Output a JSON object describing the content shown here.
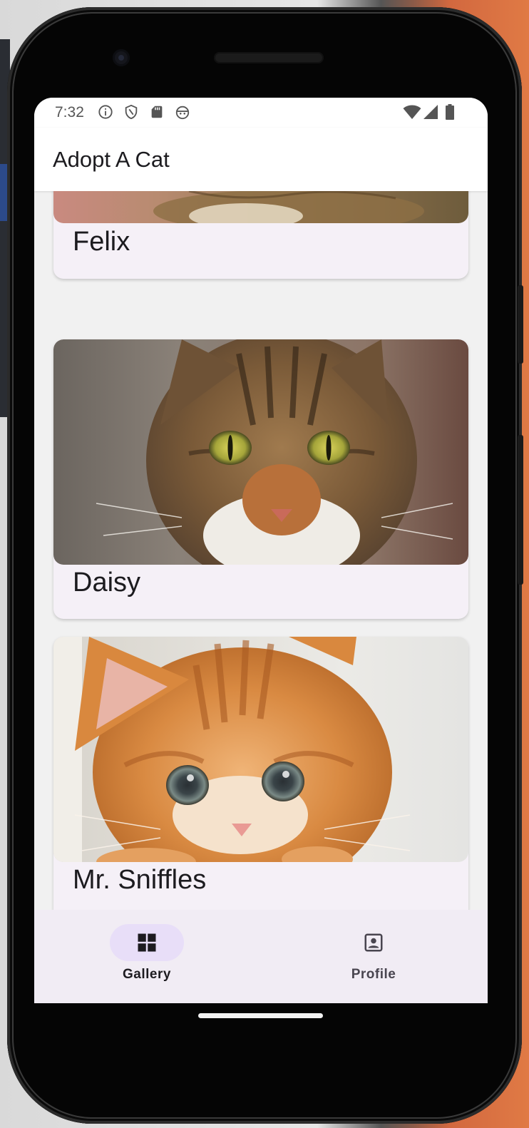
{
  "status_bar": {
    "time": "7:32",
    "left_icons": [
      "info-icon",
      "shield-icon",
      "sd-card-icon",
      "android-face-icon"
    ],
    "right_icons": [
      "wifi-icon",
      "cell-signal-icon",
      "battery-icon"
    ]
  },
  "app_bar": {
    "title": "Adopt A Cat"
  },
  "cats": [
    {
      "name": "Felix",
      "photo": "tabby-cat-photo"
    },
    {
      "name": "Daisy",
      "photo": "tabby-cat-green-eyes-photo"
    },
    {
      "name": "Mr. Sniffles",
      "photo": "orange-kitten-photo"
    }
  ],
  "bottom_nav": {
    "items": [
      {
        "label": "Gallery",
        "icon": "grid-view-icon",
        "selected": true
      },
      {
        "label": "Profile",
        "icon": "portrait-icon",
        "selected": false
      }
    ]
  },
  "colors": {
    "accent": "#e8def8",
    "card_bg": "#f5f0f7",
    "nav_bg": "#f1ecf4"
  }
}
